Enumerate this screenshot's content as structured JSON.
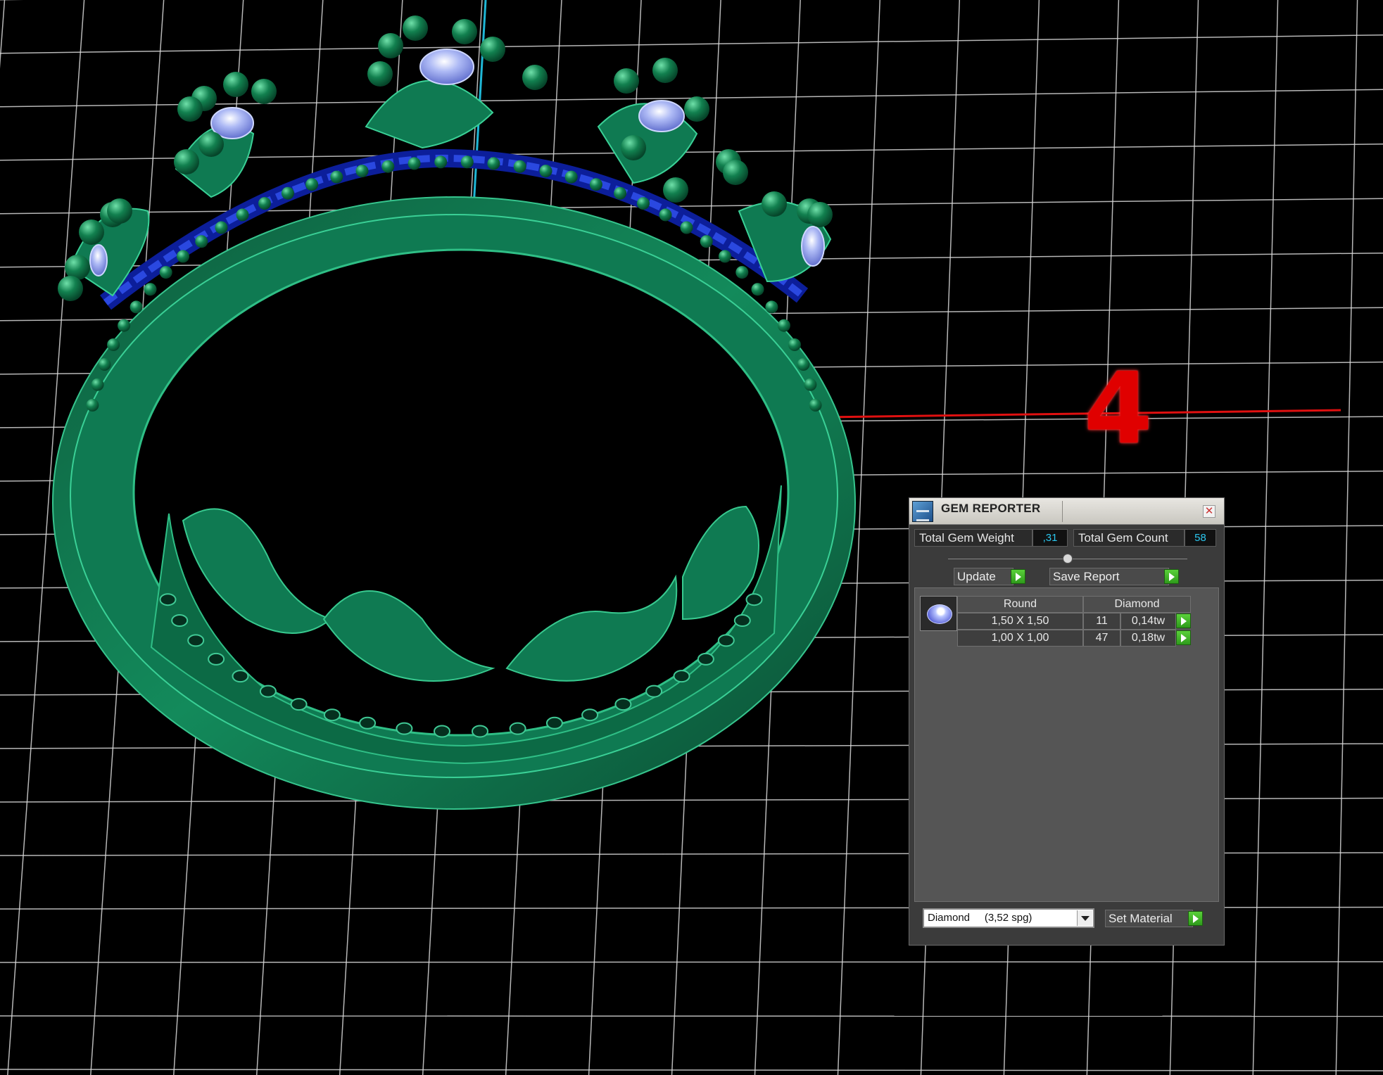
{
  "viewport": {
    "axis_label": "4",
    "colors": {
      "model": "#0f7a52",
      "grid": "#d8d8d8",
      "x_axis": "#e01010",
      "y_axis": "#1fb7d6",
      "gems": "#1a2fc0"
    }
  },
  "gem_reporter": {
    "title": "GEM REPORTER",
    "close_icon": "close-icon",
    "total_weight_label": "Total Gem Weight",
    "total_weight_value": ",31",
    "total_count_label": "Total Gem Count",
    "total_count_value": "58",
    "update_label": "Update",
    "save_report_label": "Save Report",
    "table": {
      "shape": "Round",
      "material": "Diamond",
      "rows": [
        {
          "size": "1,50 X 1,50",
          "count": "11",
          "weight": "0,14tw"
        },
        {
          "size": "1,00 X 1,00",
          "count": "47",
          "weight": "0,18tw"
        }
      ]
    },
    "material_select": "Diamond     (3,52 spg)",
    "set_material_label": "Set Material"
  }
}
